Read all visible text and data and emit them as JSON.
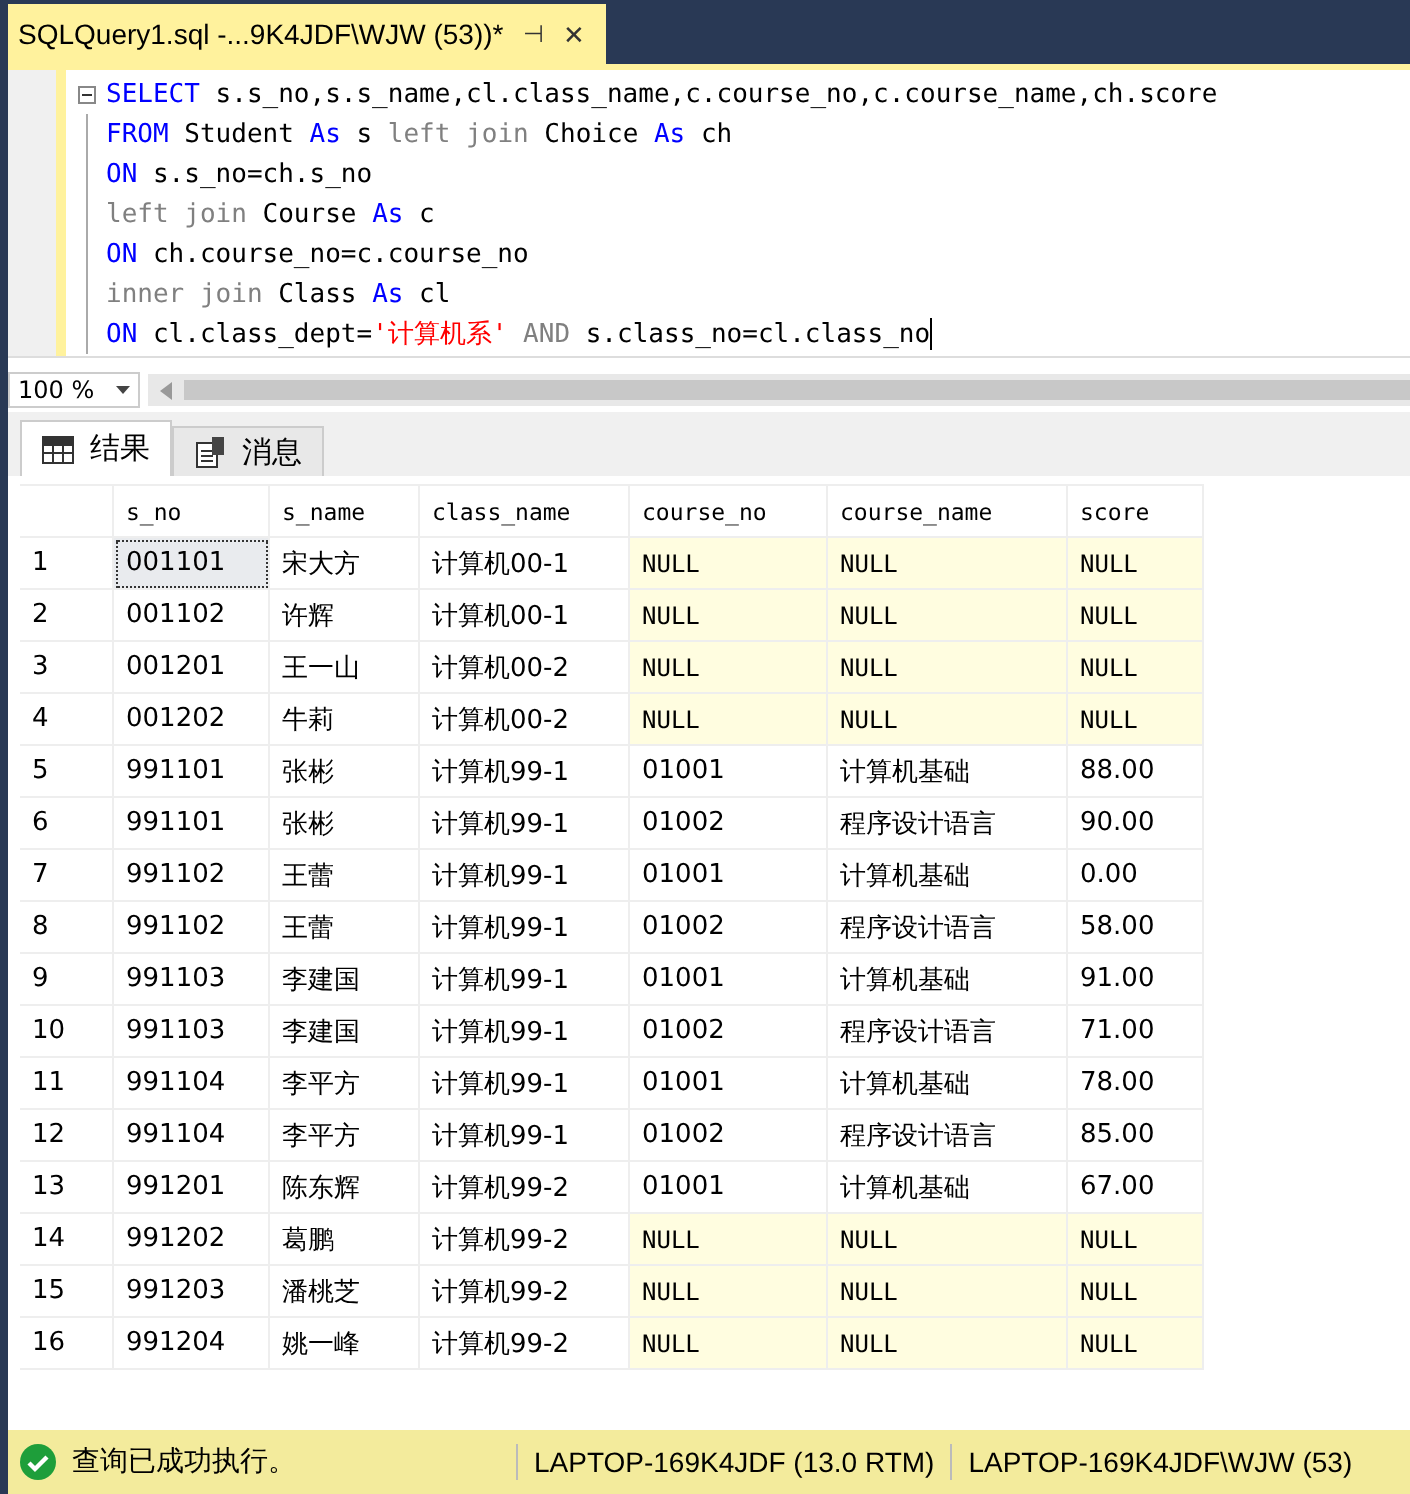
{
  "document_tab": {
    "title": "SQLQuery1.sql -...9K4JDF\\WJW (53))*",
    "pin": "⊣",
    "close": "✕"
  },
  "editor": {
    "lines": [
      [
        {
          "kind": "keyword",
          "text": "SELECT"
        },
        {
          "kind": "plain",
          "text": " s.s_no,s.s_name,cl.class_name,c.course_no,c.course_name,ch.score"
        }
      ],
      [
        {
          "kind": "keyword",
          "text": "FROM"
        },
        {
          "kind": "plain",
          "text": " Student "
        },
        {
          "kind": "keyword",
          "text": "As"
        },
        {
          "kind": "plain",
          "text": " s "
        },
        {
          "kind": "operator",
          "text": "left join"
        },
        {
          "kind": "plain",
          "text": " Choice "
        },
        {
          "kind": "keyword",
          "text": "As"
        },
        {
          "kind": "plain",
          "text": " ch"
        }
      ],
      [
        {
          "kind": "keyword",
          "text": "ON"
        },
        {
          "kind": "plain",
          "text": " s.s_no=ch.s_no"
        }
      ],
      [
        {
          "kind": "operator",
          "text": "left join"
        },
        {
          "kind": "plain",
          "text": " Course "
        },
        {
          "kind": "keyword",
          "text": "As"
        },
        {
          "kind": "plain",
          "text": " c"
        }
      ],
      [
        {
          "kind": "keyword",
          "text": "ON"
        },
        {
          "kind": "plain",
          "text": " ch.course_no=c.course_no"
        }
      ],
      [
        {
          "kind": "operator",
          "text": "inner join"
        },
        {
          "kind": "plain",
          "text": " Class "
        },
        {
          "kind": "keyword",
          "text": "As"
        },
        {
          "kind": "plain",
          "text": " cl"
        }
      ],
      [
        {
          "kind": "keyword",
          "text": "ON"
        },
        {
          "kind": "plain",
          "text": " cl.class_dept="
        },
        {
          "kind": "string",
          "text": "'计算机系'"
        },
        {
          "kind": "operator",
          "text": " AND"
        },
        {
          "kind": "plain",
          "text": " s.class_no=cl.class_no"
        }
      ]
    ]
  },
  "zoom": {
    "value": "100 %"
  },
  "result_tabs": [
    {
      "label": "结果",
      "selected": true
    },
    {
      "label": "消息",
      "selected": false
    }
  ],
  "table": {
    "columns": [
      "s_no",
      "s_name",
      "class_name",
      "course_no",
      "course_name",
      "score"
    ],
    "rows": [
      {
        "num": "1",
        "cells": [
          "001101",
          "宋大方",
          "计算机00-1",
          "NULL",
          "NULL",
          "NULL"
        ],
        "unmatched": true,
        "focused": true
      },
      {
        "num": "2",
        "cells": [
          "001102",
          "许辉",
          "计算机00-1",
          "NULL",
          "NULL",
          "NULL"
        ],
        "unmatched": true,
        "focused": false
      },
      {
        "num": "3",
        "cells": [
          "001201",
          "王一山",
          "计算机00-2",
          "NULL",
          "NULL",
          "NULL"
        ],
        "unmatched": true,
        "focused": false
      },
      {
        "num": "4",
        "cells": [
          "001202",
          "牛莉",
          "计算机00-2",
          "NULL",
          "NULL",
          "NULL"
        ],
        "unmatched": true,
        "focused": false
      },
      {
        "num": "5",
        "cells": [
          "991101",
          "张彬",
          "计算机99-1",
          "01001",
          "计算机基础",
          "88.00"
        ],
        "unmatched": false,
        "focused": false
      },
      {
        "num": "6",
        "cells": [
          "991101",
          "张彬",
          "计算机99-1",
          "01002",
          "程序设计语言",
          "90.00"
        ],
        "unmatched": false,
        "focused": false
      },
      {
        "num": "7",
        "cells": [
          "991102",
          "王蕾",
          "计算机99-1",
          "01001",
          "计算机基础",
          "0.00"
        ],
        "unmatched": false,
        "focused": false
      },
      {
        "num": "8",
        "cells": [
          "991102",
          "王蕾",
          "计算机99-1",
          "01002",
          "程序设计语言",
          "58.00"
        ],
        "unmatched": false,
        "focused": false
      },
      {
        "num": "9",
        "cells": [
          "991103",
          "李建国",
          "计算机99-1",
          "01001",
          "计算机基础",
          "91.00"
        ],
        "unmatched": false,
        "focused": false
      },
      {
        "num": "10",
        "cells": [
          "991103",
          "李建国",
          "计算机99-1",
          "01002",
          "程序设计语言",
          "71.00"
        ],
        "unmatched": false,
        "focused": false
      },
      {
        "num": "11",
        "cells": [
          "991104",
          "李平方",
          "计算机99-1",
          "01001",
          "计算机基础",
          "78.00"
        ],
        "unmatched": false,
        "focused": false
      },
      {
        "num": "12",
        "cells": [
          "991104",
          "李平方",
          "计算机99-1",
          "01002",
          "程序设计语言",
          "85.00"
        ],
        "unmatched": false,
        "focused": false
      },
      {
        "num": "13",
        "cells": [
          "991201",
          "陈东辉",
          "计算机99-2",
          "01001",
          "计算机基础",
          "67.00"
        ],
        "unmatched": false,
        "focused": false
      },
      {
        "num": "14",
        "cells": [
          "991202",
          "葛鹏",
          "计算机99-2",
          "NULL",
          "NULL",
          "NULL"
        ],
        "unmatched": true,
        "focused": false
      },
      {
        "num": "15",
        "cells": [
          "991203",
          "潘桃芝",
          "计算机99-2",
          "NULL",
          "NULL",
          "NULL"
        ],
        "unmatched": true,
        "focused": false
      },
      {
        "num": "16",
        "cells": [
          "991204",
          "姚一峰",
          "计算机99-2",
          "NULL",
          "NULL",
          "NULL"
        ],
        "unmatched": true,
        "focused": false
      }
    ]
  },
  "status_bar": {
    "success": true,
    "message": "查询已成功执行。",
    "server": "LAPTOP-169K4JDF (13.0 RTM)",
    "user": "LAPTOP-169K4JDF\\WJW (53)"
  }
}
